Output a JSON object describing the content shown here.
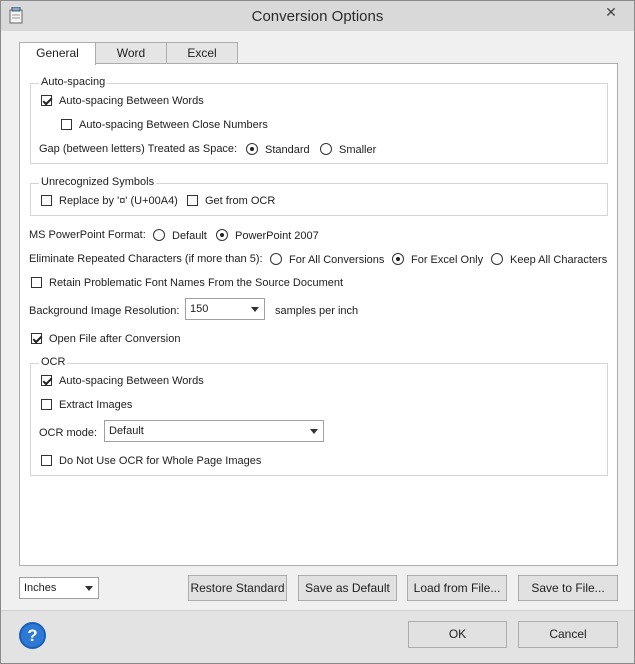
{
  "window": {
    "title": "Conversion Options",
    "close_glyph": "✕"
  },
  "tabs": [
    {
      "label": "General",
      "active": true
    },
    {
      "label": "Word",
      "active": false
    },
    {
      "label": "Excel",
      "active": false
    }
  ],
  "autospacing": {
    "title": "Auto-spacing",
    "between_words": {
      "label": "Auto-spacing Between Words",
      "checked": true
    },
    "close_numbers": {
      "label": "Auto-spacing Between Close Numbers",
      "checked": false
    },
    "gap_label": "Gap (between letters) Treated as Space:",
    "gap_options": [
      {
        "label": "Standard",
        "checked": true
      },
      {
        "label": "Smaller",
        "checked": false
      }
    ]
  },
  "unrecognized": {
    "title": "Unrecognized Symbols",
    "replace": {
      "label": "Replace by '¤' (U+00A4)",
      "checked": false
    },
    "ocr": {
      "label": "Get from OCR",
      "checked": false
    }
  },
  "ppt": {
    "label": "MS PowerPoint Format:",
    "options": [
      {
        "label": "Default",
        "checked": false
      },
      {
        "label": "PowerPoint 2007",
        "checked": true
      }
    ]
  },
  "eliminate": {
    "label": "Eliminate Repeated Characters (if more than 5):",
    "options": [
      {
        "label": "For All Conversions",
        "checked": false
      },
      {
        "label": "For Excel Only",
        "checked": true
      },
      {
        "label": "Keep All Characters",
        "checked": false
      }
    ]
  },
  "retain_fonts": {
    "label": "Retain Problematic Font Names From the Source Document",
    "checked": false
  },
  "bg_resolution": {
    "label": "Background Image Resolution:",
    "value": "150",
    "unit": "samples per inch"
  },
  "open_after": {
    "label": "Open File after Conversion",
    "checked": true
  },
  "ocr": {
    "title": "OCR",
    "autospacing": {
      "label": "Auto-spacing Between Words",
      "checked": true
    },
    "extract": {
      "label": "Extract Images",
      "checked": false
    },
    "mode_label": "OCR mode:",
    "mode_value": "Default",
    "no_ocr_whole": {
      "label": "Do Not Use OCR for Whole Page Images",
      "checked": false
    }
  },
  "units": {
    "value": "Inches"
  },
  "buttons": {
    "restore": "Restore Standard",
    "save_default": "Save as Default",
    "load": "Load from File...",
    "save_file": "Save to File...",
    "ok": "OK",
    "cancel": "Cancel",
    "help": "?"
  }
}
